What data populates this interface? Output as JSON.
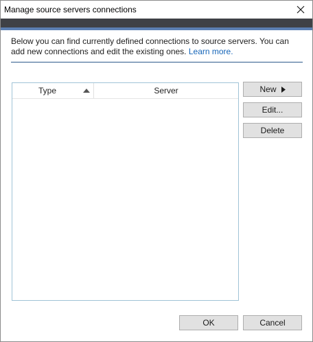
{
  "dialog": {
    "title": "Manage source servers connections"
  },
  "description": {
    "text": "Below you can find currently defined connections to source servers. You can add new connections and edit the existing ones.",
    "link": "Learn more."
  },
  "grid": {
    "columns": [
      {
        "label": "Type",
        "sort": "ascending"
      },
      {
        "label": "Server"
      }
    ],
    "rows": []
  },
  "actions": {
    "new_label": "New",
    "edit_label": "Edit...",
    "delete_label": "Delete"
  },
  "footer": {
    "ok_label": "OK",
    "cancel_label": "Cancel"
  },
  "icons": {
    "close": "close-icon",
    "sort": "sort-ascending-icon",
    "submenu": "submenu-arrow-icon"
  },
  "colors": {
    "header_band": "#3f4146",
    "header_accent": "#5c7fb3",
    "link": "#1565b8",
    "divider": "#2b5a8a",
    "grid_border": "#9fc3d6",
    "button_face": "#e1e1e1"
  }
}
